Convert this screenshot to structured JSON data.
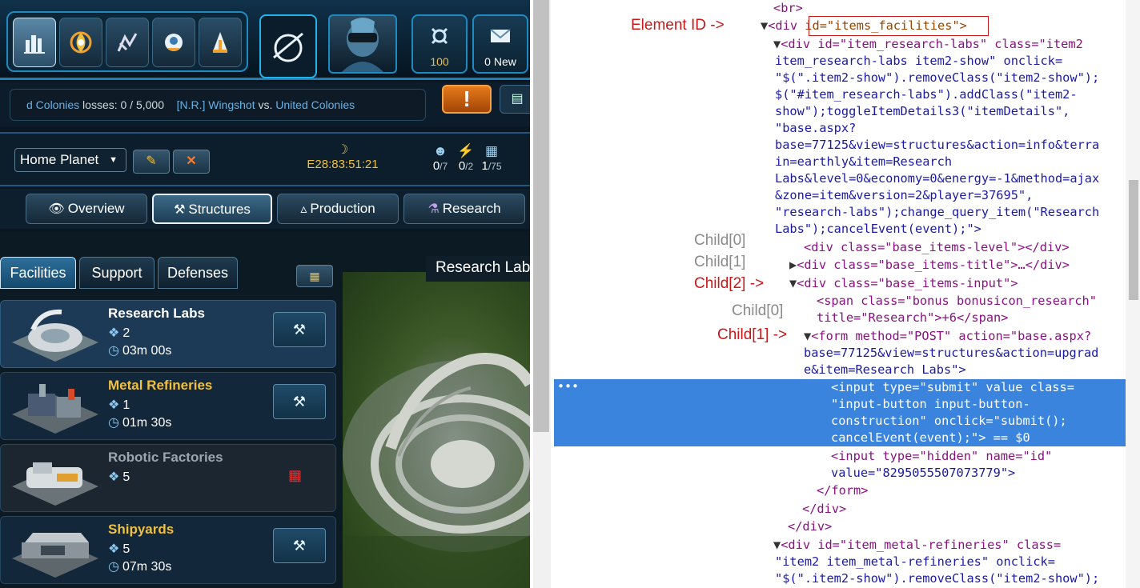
{
  "game": {
    "nav_icons": [
      "bases-icon",
      "empire-icon",
      "fleets-icon",
      "commander-icon",
      "guild-icon"
    ],
    "stats": {
      "credits_value": "100",
      "messages_value": "0 New"
    },
    "ticker": {
      "part1": "d Colonies",
      "part2": " losses: 0 / 5,000",
      "attacker": "[N.R.] Wingshot",
      "vs": " vs. ",
      "defender": "United Colonies"
    },
    "alert_symbol": "!",
    "planet": {
      "selected": "Home Planet",
      "time": "E28:83:51:21",
      "population": "0",
      "population_max": "/7",
      "energy": "0",
      "energy_max": "/2",
      "area": "1",
      "area_max": "/75"
    },
    "main_tabs": [
      "Overview",
      "Structures",
      "Production",
      "Research"
    ],
    "sub_tabs": [
      "Facilities",
      "Support",
      "Defenses"
    ],
    "preview_title": "Research Labs",
    "items": [
      {
        "name": "Research Labs",
        "level": "2",
        "time": "03m 00s"
      },
      {
        "name": "Metal Refineries",
        "level": "1",
        "time": "01m 30s"
      },
      {
        "name": "Robotic Factories",
        "level": "5",
        "time": ""
      },
      {
        "name": "Shipyards",
        "level": "5",
        "time": "07m 30s"
      }
    ]
  },
  "devtools": {
    "annotations": {
      "element_id": "Element ID ->",
      "child0_a": "Child[0]",
      "child1_a": "Child[1]",
      "child2": "Child[2] ->",
      "child0_b": "Child[0]",
      "child1_b": "Child[1] ->"
    },
    "lines": {
      "l0": "<br>",
      "l1_a": "<div ",
      "l1_b": "id=\"items_facilities\">",
      "l2": "<div id=\"item_research-labs\" class=\"item2",
      "l3": "item_research-labs item2-show\" onclick=",
      "l4": "\"$(\".item2-show\").removeClass(\"item2-show\");",
      "l5": "$(\"#item_research-labs\").addClass(\"item2-",
      "l6": "show\");toggleItemDetails3(\"itemDetails\",",
      "l7": "\"base.aspx?",
      "l8": "base=77125&view=structures&action=info&terra",
      "l9": "in=earthly&item=Research",
      "l10": "Labs&level=0&economy=0&energy=-1&method=ajax",
      "l11": "&zone=item&version=2&player=37695\",",
      "l12": "\"research-labs\");change_query_item(\"Research",
      "l13": "Labs\");cancelEvent(event);\">",
      "l14": "<div class=\"base_items-level\"></div>",
      "l15": "<div class=\"base_items-title\">…</div>",
      "l16": "<div class=\"base_items-input\">",
      "l17": "<span class=\"bonus bonusicon_research\"",
      "l18": "title=\"Research\">+6</span>",
      "l19": "<form method=\"POST\" action=\"base.aspx?",
      "l20": "base=77125&view=structures&action=upgrad",
      "l21": "e&item=Research Labs\">",
      "l22": "<input type=\"submit\" value class=",
      "l23": "\"input-button input-button-",
      "l24": "construction\" onclick=\"submit();",
      "l25": "cancelEvent(event);\"> == $0",
      "l26": "<input type=\"hidden\" name=\"id\"",
      "l27": "value=\"8295055507073779\">",
      "l28": "</form>",
      "l29": "</div>",
      "l30": "</div>",
      "l31": "<div id=\"item_metal-refineries\" class=",
      "l32": "\"item2 item_metal-refineries\" onclick=",
      "l33": "\"$(\".item2-show\").removeClass(\"item2-show\");"
    },
    "selection_marker": "•••"
  }
}
